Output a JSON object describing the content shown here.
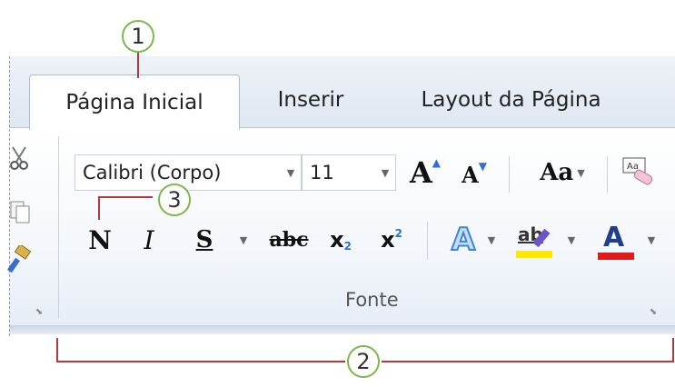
{
  "tabs": [
    {
      "label": "Página Inicial",
      "active": true
    },
    {
      "label": "Inserir",
      "active": false
    },
    {
      "label": "Layout da Página",
      "active": false
    }
  ],
  "callouts": {
    "one": "1",
    "two": "2",
    "three": "3"
  },
  "font_group": {
    "font_name": "Calibri (Corpo)",
    "font_size": "11",
    "group_label": "Fonte",
    "grow_font": "A",
    "shrink_font": "A",
    "change_case": "Aa",
    "bold": "N",
    "italic": "I",
    "underline": "S",
    "strikethrough": "abc",
    "subscript": "x",
    "subscript_mark": "2",
    "superscript": "x",
    "superscript_mark": "2",
    "text_effects": "A",
    "highlight": "ab",
    "font_color": "A"
  },
  "colors": {
    "callout_border": "#7bb84a",
    "callout_line": "#b23a3a",
    "highlight_yellow": "#ffe800",
    "font_color_red": "#e01b1b"
  }
}
